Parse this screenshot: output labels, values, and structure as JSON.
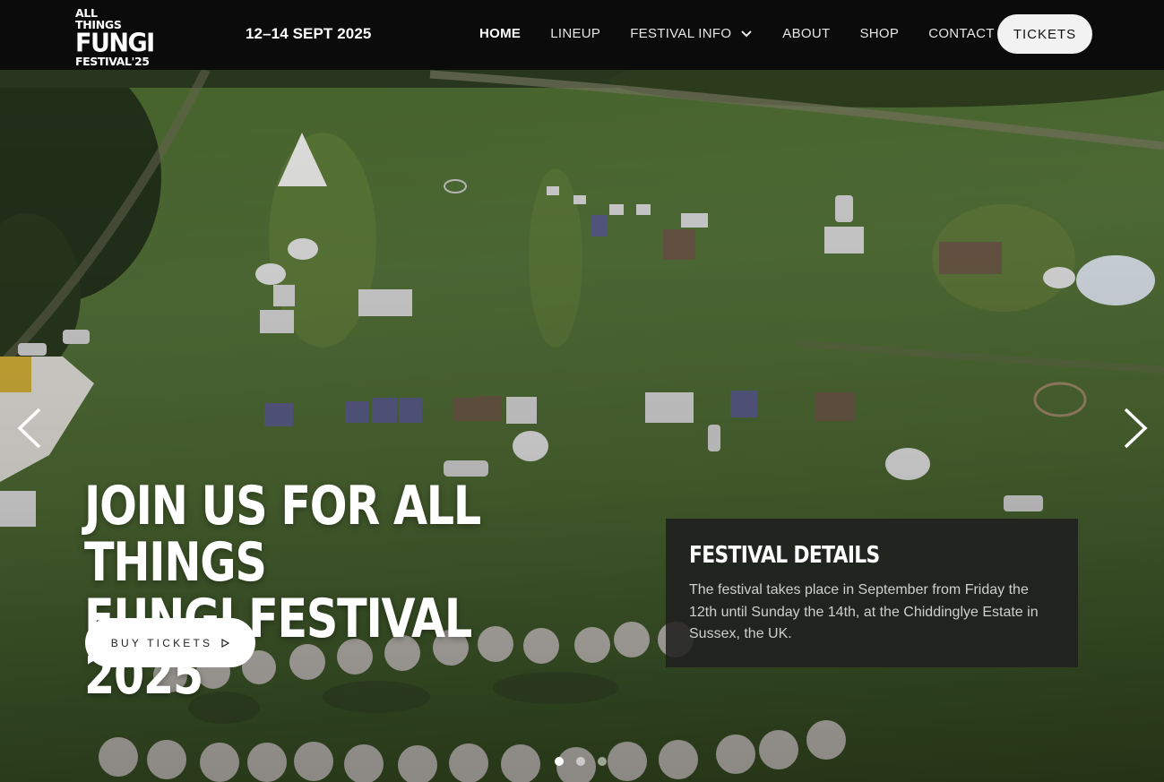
{
  "header": {
    "logo": {
      "line1": "ALL THINGS",
      "line2": "FUNGI",
      "line3": "FESTIVAL'25"
    },
    "dates": "12–14 SEPT 2025",
    "nav": [
      {
        "label": "HOME",
        "active": true
      },
      {
        "label": "LINEUP"
      },
      {
        "label": "FESTIVAL INFO",
        "dropdown": true
      },
      {
        "label": "ABOUT"
      },
      {
        "label": "SHOP"
      },
      {
        "label": "CONTACT"
      }
    ],
    "tickets_label": "TICKETS"
  },
  "hero": {
    "title_line1": "JOIN US FOR ALL THINGS",
    "title_line2": "FUNGI FESTIVAL 2025",
    "buy_label": "BUY TICKETS",
    "details": {
      "heading": "FESTIVAL DETAILS",
      "body": "The festival takes place in September from Friday the 12th until Sunday the 14th, at the Chiddinglye Estate in Sussex, the UK."
    },
    "slides": {
      "count": 3,
      "active": 1
    }
  },
  "icons": {
    "prev": "chevron-left-icon",
    "next": "chevron-right-icon",
    "dropdown": "chevron-down-icon",
    "buy": "play-outline-icon"
  },
  "colors": {
    "header_bg": "#0b0b0b",
    "button_bg": "#f2f2f2",
    "details_bg": "#1e1e1e",
    "field_green": "#4f6b33"
  }
}
